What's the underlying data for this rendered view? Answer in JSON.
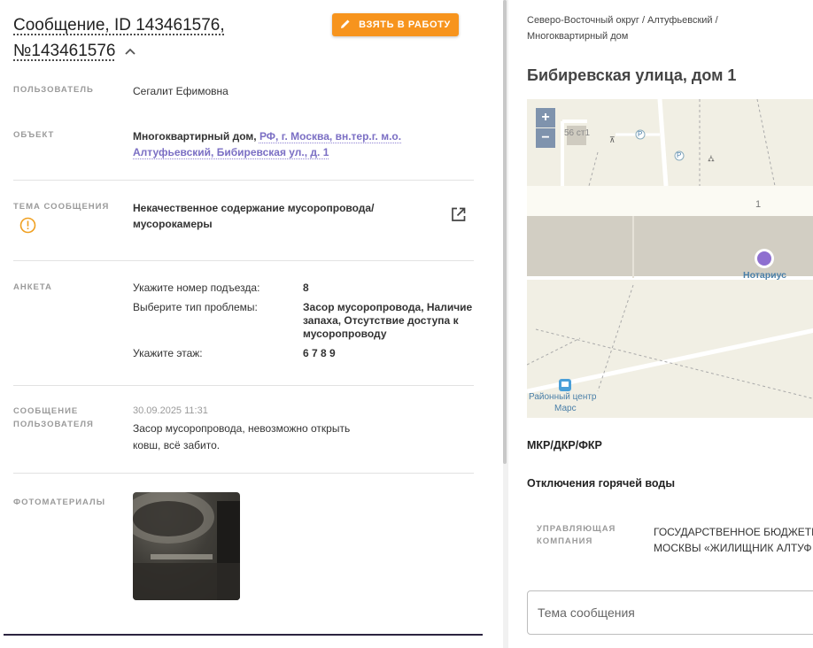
{
  "header": {
    "title_line1": "Сообщение, ID 143461576,",
    "title_line2": "№143461576",
    "take_button": "ВЗЯТЬ В РАБОТУ"
  },
  "fields": {
    "user_label": "ПОЛЬЗОВАТЕЛЬ",
    "user_value": "Сегалит Ефимовна",
    "object_label": "ОБЪЕКТ",
    "object_type": "Многоквартирный дом,",
    "object_link": "РФ, г. Москва, вн.тер.г. м.о. Алтуфьевский, Бибиревская ул., д. 1",
    "topic_label": "ТЕМА СООБЩЕНИЯ",
    "topic_value": "Некачественное содержание мусоропровода/ мусорокамеры",
    "form_label": "АНКЕТА",
    "message_label_1": "СООБЩЕНИЕ",
    "message_label_2": "ПОЛЬЗОВАТЕЛЯ",
    "message_date": "30.09.2025 11:31",
    "message_text": "Засор мусоропровода, невозможно открыть ковш, всё забито.",
    "photos_label": "ФОТОМАТЕРИАЛЫ"
  },
  "form": [
    {
      "q": "Укажите номер подъезда:",
      "a": "8"
    },
    {
      "q": "Выберите тип проблемы:",
      "a": "Засор мусоропровода, Наличие запаха, Отсутствие доступа к мусоропроводу"
    },
    {
      "q": "Укажите этаж:",
      "a": "6 7 8 9"
    }
  ],
  "right": {
    "breadcrumb": "Северо-Восточный округ / Алтуфьевский / Многоквартирный дом",
    "address": "Бибиревская улица, дом 1",
    "map": {
      "zoom_in": "+",
      "zoom_out": "−",
      "building_label": "56 ст1",
      "house_number": "1",
      "poi_notary": "Нотариус",
      "poi_mall_1": "Районный центр",
      "poi_mall_2": "Марс",
      "parking_1": "P",
      "parking_2": "P"
    },
    "section_mkr": "МКР/ДКР/ФКР",
    "section_hot_water": "Отключения горячей воды",
    "uk_label_1": "УПРАВЛЯЮЩАЯ",
    "uk_label_2": "КОМПАНИЯ",
    "uk_value_1": "ГОСУДАРСТВЕННОЕ БЮДЖЕТН",
    "uk_value_2": "МОСКВЫ «ЖИЛИЩНИК АЛТУФ",
    "topic_placeholder": "Тема сообщения"
  },
  "colors": {
    "accent_orange": "#f7941d",
    "link_purple": "#7b6fc4",
    "warning_orange": "#f0a020"
  }
}
